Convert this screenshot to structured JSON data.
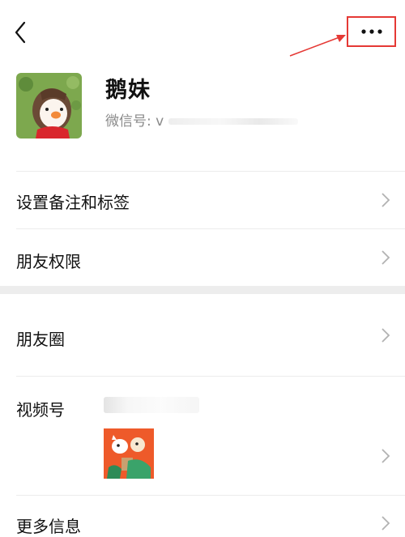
{
  "topbar": {
    "back_icon": "chevron-left-icon",
    "more_icon": "more-dots-icon",
    "highlight_color": "#e53935"
  },
  "profile": {
    "nickname": "鹅妹",
    "wechat_id_label": "微信号: v"
  },
  "menu": {
    "set_remark_tags": "设置备注和标签",
    "friend_permissions": "朋友权限",
    "moments": "朋友圈",
    "channels": "视频号",
    "more_info": "更多信息"
  },
  "colors": {
    "separator": "#ededed",
    "chevron": "#b2b2b2",
    "secondary_text": "#8a8a8a"
  }
}
